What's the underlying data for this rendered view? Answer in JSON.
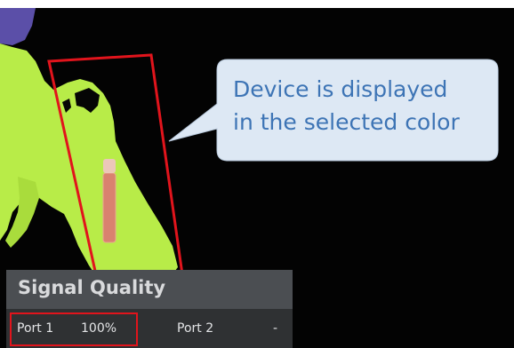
{
  "callout": {
    "line1": "Device is displayed",
    "line2": "in the selected color"
  },
  "panel": {
    "title": "Signal Quality",
    "ports": [
      {
        "label": "Port 1",
        "value": "100%"
      },
      {
        "label": "Port 2",
        "value": "-"
      }
    ]
  },
  "colors": {
    "anatomy": "#b8ec48",
    "device": "#d9826f",
    "highlight": "#e1141c",
    "callout_fill": "#dde8f4",
    "callout_text": "#3d74b5"
  }
}
